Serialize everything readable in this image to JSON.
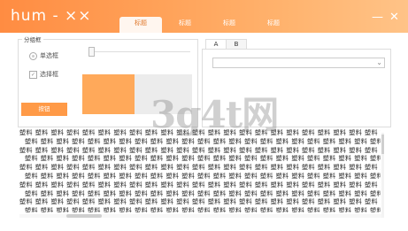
{
  "window": {
    "title": "hum - ××",
    "minimize_label": "—",
    "close_label": "✕"
  },
  "tabs": [
    {
      "label": "标题",
      "active": true
    },
    {
      "label": "标题",
      "active": false
    },
    {
      "label": "标题",
      "active": false
    },
    {
      "label": "标题",
      "active": false
    }
  ],
  "group": {
    "legend": "分组框",
    "radio_label": "单选框",
    "checkbox_label": "选择框",
    "checkbox_mark": "✓",
    "button_label": "按钮"
  },
  "right_panel": {
    "tabs": [
      {
        "label": "A"
      },
      {
        "label": "B"
      }
    ],
    "dropdown_value": "",
    "dropdown_arrow": "⌄"
  },
  "textarea": {
    "pattern_row": "塑料  塑料  塑料  塑料  塑料  塑料  塑料  塑料  塑料  塑料  塑料  塑料  塑料  塑料  塑料  塑料  塑料  塑料  塑料  塑料  塑料  塑料  塑料  塑料  塑料  塑料"
  },
  "watermark": "3g4t网",
  "colors": {
    "accent": "#ff9a47",
    "header_gradient_start": "#ff8c42",
    "header_gradient_end": "#ffc387"
  }
}
